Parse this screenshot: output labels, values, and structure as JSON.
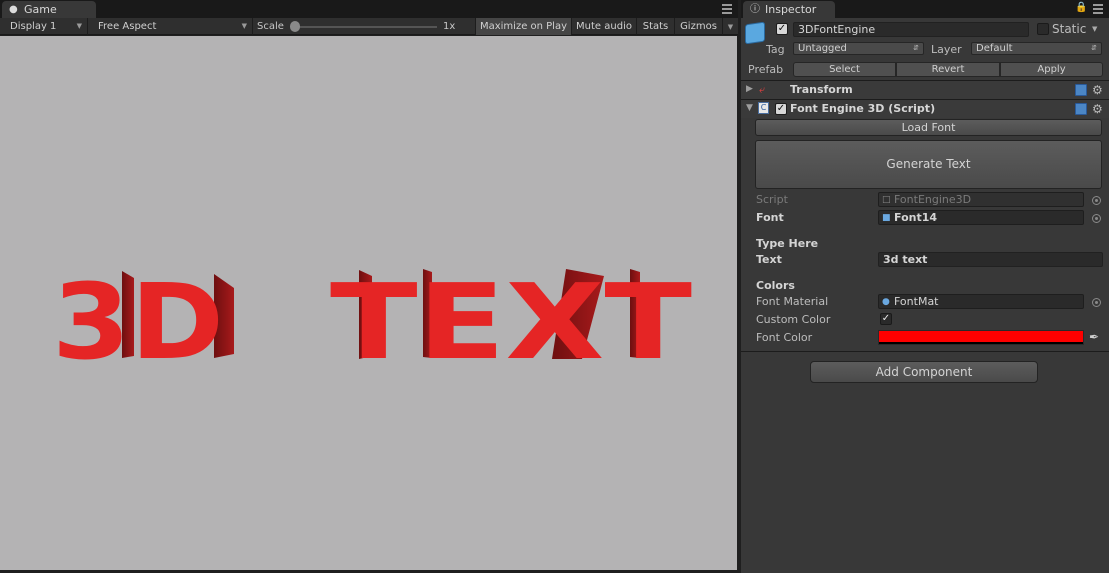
{
  "game": {
    "tab_label": "Game",
    "display_label": "Display 1",
    "aspect_label": "Free Aspect",
    "scale_label": "Scale",
    "scale_value": "1x",
    "maximize_label": "Maximize on Play",
    "mute_label": "Mute audio",
    "stats_label": "Stats",
    "gizmos_label": "Gizmos",
    "viewport_text_left": "3D",
    "viewport_text_right": "TEXT",
    "viewport_bg": "#b4b3b4",
    "text_color": "#e52525"
  },
  "inspector": {
    "tab_label": "Inspector",
    "object_name": "3DFontEngine",
    "static_label": "Static",
    "tag_label": "Tag",
    "tag_value": "Untagged",
    "layer_label": "Layer",
    "layer_value": "Default",
    "prefab_label": "Prefab",
    "prefab_select": "Select",
    "prefab_revert": "Revert",
    "prefab_apply": "Apply",
    "transform_title": "Transform",
    "component_title": "Font Engine 3D (Script)",
    "load_font_label": "Load Font",
    "generate_text_label": "Generate Text",
    "script_label": "Script",
    "script_value": "FontEngine3D",
    "font_label": "Font",
    "font_value": "Font14",
    "type_here_header": "Type Here",
    "text_label": "Text",
    "text_value": "3d text",
    "colors_header": "Colors",
    "font_material_label": "Font Material",
    "font_material_value": "FontMat",
    "custom_color_label": "Custom Color",
    "custom_color_checked": true,
    "font_color_label": "Font Color",
    "font_color_value": "#ff0000",
    "add_component_label": "Add Component"
  }
}
